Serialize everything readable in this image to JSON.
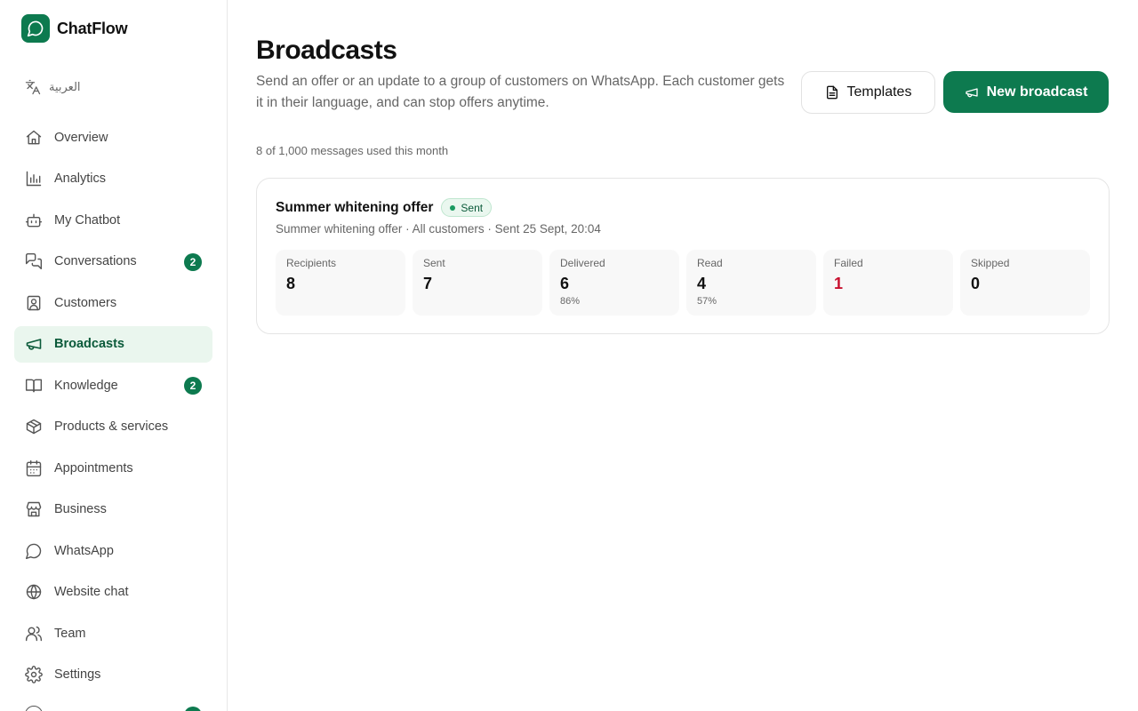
{
  "app": {
    "name": "ChatFlow",
    "brand_color": "#0d7a4f"
  },
  "language_switch": {
    "label": "العربية",
    "icon": "translate-icon"
  },
  "nav": {
    "items": [
      {
        "label": "Overview",
        "icon": "home-icon"
      },
      {
        "label": "Analytics",
        "icon": "bar-chart-icon"
      },
      {
        "label": "My Chatbot",
        "icon": "bot-icon"
      },
      {
        "label": "Conversations",
        "icon": "chat-bubbles-icon",
        "badge": "2"
      },
      {
        "label": "Customers",
        "icon": "contact-card-icon"
      },
      {
        "label": "Broadcasts",
        "icon": "megaphone-icon",
        "active": true
      },
      {
        "label": "Knowledge",
        "icon": "book-icon",
        "badge": "2"
      },
      {
        "label": "Products & services",
        "icon": "box-icon"
      },
      {
        "label": "Appointments",
        "icon": "calendar-icon"
      },
      {
        "label": "Business",
        "icon": "store-icon"
      },
      {
        "label": "WhatsApp",
        "icon": "whatsapp-bubble-icon"
      },
      {
        "label": "Website chat",
        "icon": "globe-icon"
      },
      {
        "label": "Team",
        "icon": "users-icon"
      },
      {
        "label": "Settings",
        "icon": "gear-icon"
      }
    ]
  },
  "header": {
    "title": "Broadcasts",
    "description": "Send an offer or an update to a group of customers on WhatsApp. Each customer gets it in their language, and can stop offers anytime.",
    "templates_button": "Templates",
    "new_broadcast_button": "New broadcast"
  },
  "usage": {
    "text": "8 of 1,000 messages used this month"
  },
  "broadcasts": [
    {
      "title": "Summer whitening offer",
      "status": "Sent",
      "status_color": "#1a9a60",
      "meta": "Summer whitening offer · All customers · Sent 25 Sept, 20:04",
      "stats": [
        {
          "label": "Recipients",
          "value": "8"
        },
        {
          "label": "Sent",
          "value": "7"
        },
        {
          "label": "Delivered",
          "value": "6",
          "sub": "86%"
        },
        {
          "label": "Read",
          "value": "4",
          "sub": "57%"
        },
        {
          "label": "Failed",
          "value": "1",
          "color": "#c8102e"
        },
        {
          "label": "Skipped",
          "value": "0"
        }
      ]
    }
  ]
}
